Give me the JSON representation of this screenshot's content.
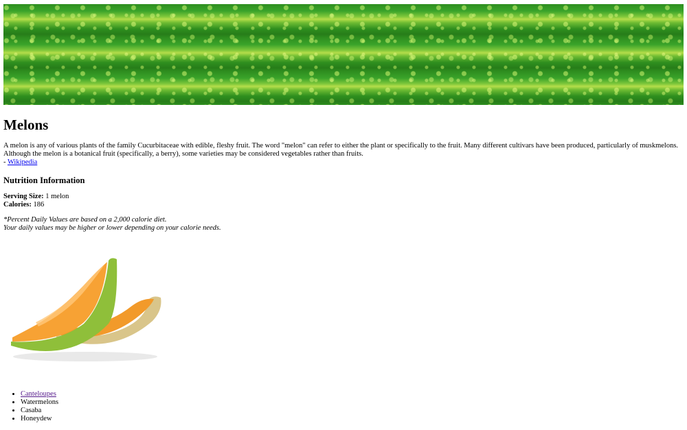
{
  "banner": {
    "icon": "watermelon-rind-banner"
  },
  "page": {
    "title": "Melons",
    "description": "A melon is any of various plants of the family Cucurbitaceae with edible, fleshy fruit. The word \"melon\" can refer to either the plant or specifically to the fruit. Many different cultivars have been produced, particularly of muskmelons. Although the melon is a botanical fruit (specifically, a berry), some varieties may be considered vegetables rather than fruits.",
    "source_prefix": "- ",
    "source_link": "Wikipedia"
  },
  "nutrition": {
    "heading": "Nutrition Information",
    "serving_label": "Serving Size:",
    "serving_value": " 1 melon",
    "calories_label": "Calories:",
    "calories_value": " 186",
    "note_line1": "*Percent Daily Values are based on a 2,000 calorie diet.",
    "note_line2": "Your daily values may be higher or lower depending on your calorie needs."
  },
  "image": {
    "icon": "cantaloupe-slices-image"
  },
  "list": {
    "items": [
      {
        "label": "Canteloupes",
        "link": true
      },
      {
        "label": "Watermelons",
        "link": false
      },
      {
        "label": "Casaba",
        "link": false
      },
      {
        "label": "Honeydew",
        "link": false
      }
    ]
  },
  "colors": {
    "link": "#0000ee",
    "visited_link": "#551a8b",
    "melon_flesh": "#f7a234",
    "melon_rind": "#8fbf3a"
  }
}
